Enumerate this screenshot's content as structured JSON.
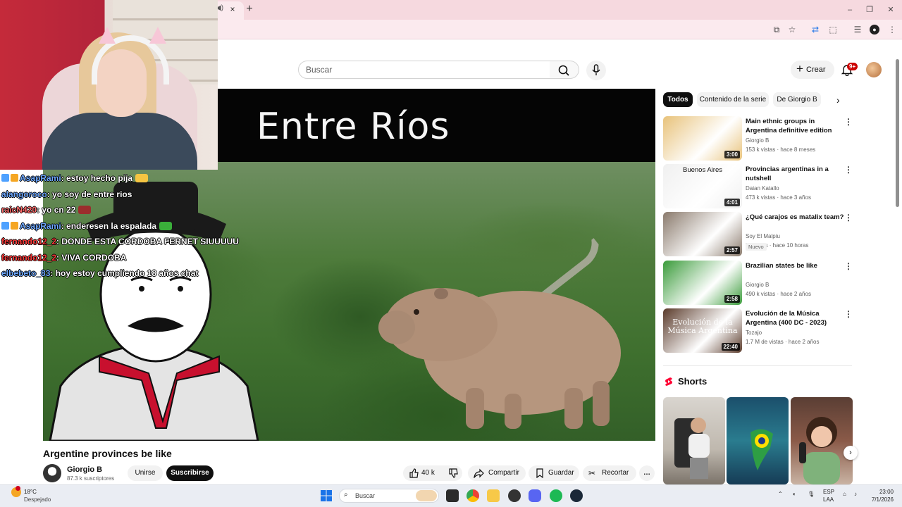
{
  "browser": {
    "tab_close": "×",
    "new_tab": "+",
    "window_controls": [
      "–",
      "❐",
      "✕"
    ]
  },
  "header": {
    "search_placeholder": "Buscar",
    "create_label": "Crear",
    "notifications_badge": "9+"
  },
  "video": {
    "overlay_title": "Entre Ríos",
    "title": "Argentine provinces be like",
    "channel": "Giorgio B",
    "subscribers": "87.3 k suscriptores",
    "join_label": "Unirse",
    "subscribe_label": "Suscribirse",
    "likes": "40 k",
    "share_label": "Compartir",
    "save_label": "Guardar",
    "clip_label": "Recortar",
    "more_label": "…"
  },
  "chat": [
    {
      "user": "AsapRami",
      "user_color": "#6ea8ff",
      "message": "estoy hecho pija",
      "badges": true
    },
    {
      "user": "alangoroco",
      "user_color": "#6ea8ff",
      "message": "yo soy de entre rios",
      "badges": false
    },
    {
      "user": "raicN420",
      "user_color": "#ff6b6b",
      "message": "yo cn 22",
      "badges": false
    },
    {
      "user": "AsapRami",
      "user_color": "#6ea8ff",
      "message": "enderesen la espalada",
      "badges": true
    },
    {
      "user": "fernando12_2",
      "user_color": "#ff3b3b",
      "message": "DONDE ESTA CORDOBA FERNET SIUUUUU",
      "badges": false
    },
    {
      "user": "fernando12_2",
      "user_color": "#ff3b3b",
      "message": "VIVA CORDOBA",
      "badges": false
    },
    {
      "user": "elbebeto_83",
      "user_color": "#6ea8ff",
      "message": "hoy estoy cumpliendo 18 años chat",
      "badges": false
    }
  ],
  "filters": [
    "Todos",
    "Contenido de la serie",
    "De Giorgio B"
  ],
  "recommendations": [
    {
      "title": "Main ethnic groups in Argentina definitive edition",
      "channel": "Giorgio B",
      "meta": "153 k vistas · hace 8 meses",
      "duration": "3:00",
      "thumb_bg": "#e8c27a"
    },
    {
      "title": "Provincias argentinas in a nutshell",
      "channel": "Daian Katallo",
      "meta": "473 k vistas · hace 3 años",
      "duration": "4:01",
      "thumb_label": "Buenos Aires",
      "thumb_bg": "#f0f0f0"
    },
    {
      "title": "¿Qué carajos es matalix team?",
      "channel": "Soy El Malpiu",
      "meta": "56 vistas · hace 10 horas",
      "duration": "2:57",
      "badge": "Nuevo",
      "thumb_bg": "#8a7a6c"
    },
    {
      "title": "Brazilian states be like",
      "channel": "Giorgio B",
      "meta": "490 k vistas · hace 2 años",
      "duration": "2:58",
      "thumb_bg": "#3a9b3a"
    },
    {
      "title": "Evolución de la Música Argentina (400 DC - 2023)",
      "channel": "Tozajo",
      "meta": "1.7 M de vistas · hace 2 años",
      "duration": "22:40",
      "thumb_label": "Evolución de la Música Argentina",
      "thumb_bg": "#5a3a2a"
    }
  ],
  "shorts": {
    "title": "Shorts",
    "next": "›"
  },
  "taskbar": {
    "temperature": "18°C",
    "weather": "Despejado",
    "search_placeholder": "Buscar",
    "lang_top": "ESP",
    "lang_bottom": "LAA",
    "time": "23:00",
    "date": "7/1/2026"
  },
  "colors": {
    "accent": "#0f0f0f",
    "tab_strip": "#f6d9df",
    "youtube_red": "#ff0033"
  }
}
